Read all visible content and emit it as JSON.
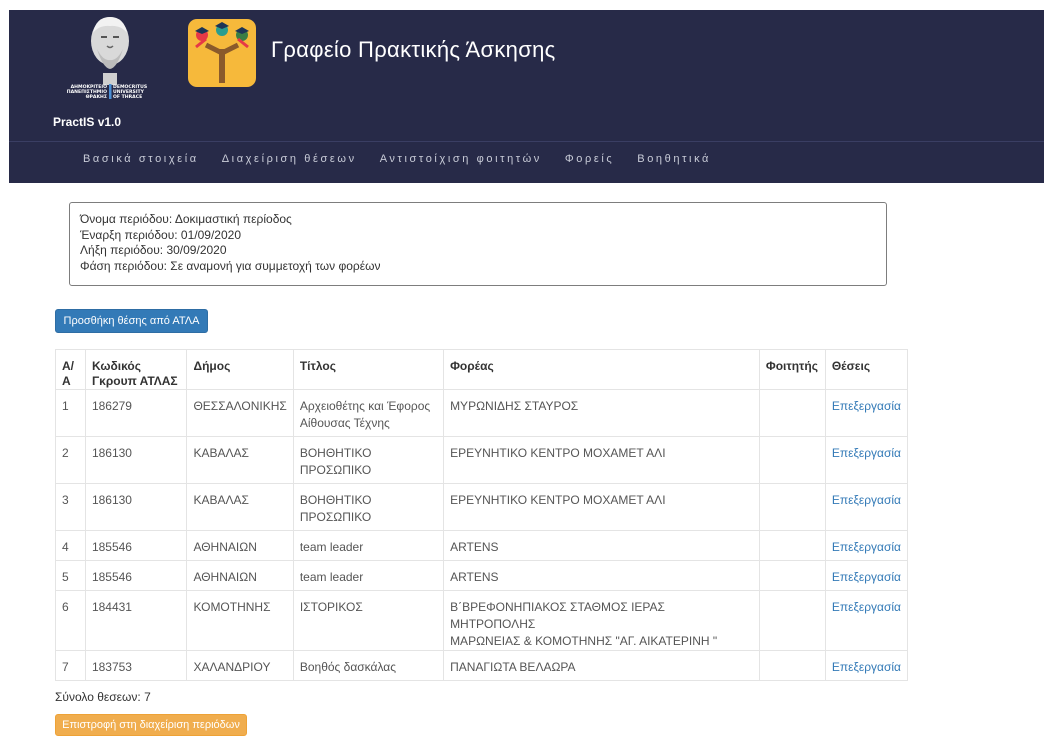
{
  "header": {
    "app_title": "Γραφείο Πρακτικής Άσκησης",
    "brand": "PractIS v1.0",
    "university_logo_lines": [
      "ΔΗΜΟΚΡΙΤΕΙΟ",
      "ΠΑΝΕΠΙΣΤΗΜΙΟ",
      "ΘΡΑΚΗΣ",
      "DEMOCRITUS",
      "UNIVERSITY",
      "OF THRACE"
    ]
  },
  "nav": {
    "items": [
      {
        "label": "Βασικά στοιχεία"
      },
      {
        "label": "Διαχείριση θέσεων"
      },
      {
        "label": "Αντιστοίχιση φοιτητών"
      },
      {
        "label": "Φορείς"
      },
      {
        "label": "Βοηθητικά"
      }
    ]
  },
  "period": {
    "name": "Όνομα περιόδου: Δοκιμαστική περίοδος",
    "start": "Έναρξη περιόδου: 01/09/2020",
    "end": "Λήξη περιόδου: 30/09/2020",
    "phase": "Φάση περιόδου: Σε αναμονή για συμμετοχή των φορέων"
  },
  "actions": {
    "add_label": "Προσθήκη θέσης από ΑΤΛΑ",
    "back_label": "Επιστροφή στη διαχείριση περιόδων"
  },
  "table": {
    "headers": {
      "aa": "Α/Α",
      "code_line1": "Κωδικός",
      "code_line2": "Γκρουπ ΑΤΛΑΣ",
      "municipality": "Δήμος",
      "title": "Τίτλος",
      "organization": "Φορέας",
      "student": "Φοιτητής",
      "positions": "Θέσεις"
    },
    "rows": [
      {
        "aa": "1",
        "code": "186279",
        "municipality": "ΘΕΣΣΑΛΟΝΙΚΗΣ",
        "title_1": "Αρχειοθέτης και Έφορος",
        "title_2": "Αίθουσας Τέχνης",
        "org_1": "ΜΥΡΩΝΙΔΗΣ ΣΤΑΥΡΟΣ",
        "org_2": "",
        "student": "",
        "action": "Επεξεργασία"
      },
      {
        "aa": "2",
        "code": "186130",
        "municipality": "ΚΑΒΑΛΑΣ",
        "title_1": "ΒΟΗΘΗΤΙΚΟ",
        "title_2": "ΠΡΟΣΩΠΙΚΟ",
        "org_1": "ΕΡΕΥΝΗΤΙΚΟ ΚΕΝΤΡΟ ΜΟΧΑΜΕΤ ΑΛΙ",
        "org_2": "",
        "student": "",
        "action": "Επεξεργασία"
      },
      {
        "aa": "3",
        "code": "186130",
        "municipality": "ΚΑΒΑΛΑΣ",
        "title_1": "ΒΟΗΘΗΤΙΚΟ",
        "title_2": "ΠΡΟΣΩΠΙΚΟ",
        "org_1": "ΕΡΕΥΝΗΤΙΚΟ ΚΕΝΤΡΟ ΜΟΧΑΜΕΤ ΑΛΙ",
        "org_2": "",
        "student": "",
        "action": "Επεξεργασία"
      },
      {
        "aa": "4",
        "code": "185546",
        "municipality": "ΑΘΗΝΑΙΩΝ",
        "title_1": "team leader",
        "title_2": "",
        "org_1": "ARTENS",
        "org_2": "",
        "student": "",
        "action": "Επεξεργασία"
      },
      {
        "aa": "5",
        "code": "185546",
        "municipality": "ΑΘΗΝΑΙΩΝ",
        "title_1": "team leader",
        "title_2": "",
        "org_1": "ARTENS",
        "org_2": "",
        "student": "",
        "action": "Επεξεργασία"
      },
      {
        "aa": "6",
        "code": "184431",
        "municipality": "ΚΟΜΟΤΗΝΗΣ",
        "title_1": "ΙΣΤΟΡΙΚΟΣ",
        "title_2": "",
        "org_1": "Β΄ΒΡΕΦΟΝΗΠΙΑΚΟΣ ΣΤΑΘΜΟΣ ΙΕΡΑΣ ΜΗΤΡΟΠΟΛΗΣ",
        "org_2": "ΜΑΡΩΝΕΙΑΣ & ΚΟΜΟΤΗΝΗΣ \"ΑΓ. ΑΙΚΑΤΕΡΙΝΗ \"",
        "student": "",
        "action": "Επεξεργασία"
      },
      {
        "aa": "7",
        "code": "183753",
        "municipality": "ΧΑΛΑΝΔΡΙΟΥ",
        "title_1": "Βοηθός δασκάλας",
        "title_2": "",
        "org_1": "ΠΑΝΑΓΙΩΤΑ ΒΕΛΑΩΡΑ",
        "org_2": "",
        "student": "",
        "action": "Επεξεργασία"
      }
    ]
  },
  "footer": {
    "total": "Σύνολο θεσεων: 7"
  },
  "colors": {
    "header_bg": "#272a48",
    "primary": "#337ab7",
    "warning": "#f0ad4e",
    "app_icon_bg": "#f6b93b"
  },
  "icons": [
    "university-seal-icon",
    "practice-office-app-icon"
  ]
}
